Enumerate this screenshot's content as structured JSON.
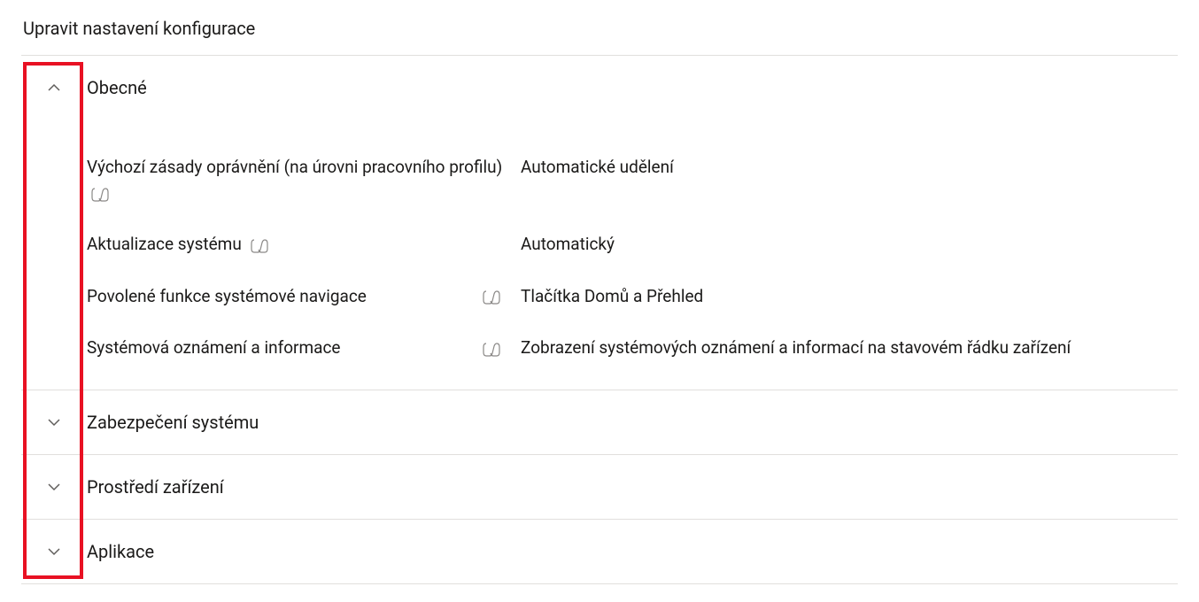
{
  "page": {
    "title": "Upravit nastavení konfigurace"
  },
  "sections": [
    {
      "title": "Obecné",
      "expanded": true,
      "settings": [
        {
          "label": "Výchozí zásady oprávnění (na úrovni pracovního profilu)",
          "value": "Automatické udělení",
          "icon_inline": true
        },
        {
          "label": "Aktualizace systému",
          "value": "Automatický",
          "icon_inline": true
        },
        {
          "label": "Povolené funkce systémové navigace",
          "value": "Tlačítka Domů a Přehled",
          "icon_trailing": true
        },
        {
          "label": "Systémová oznámení a informace",
          "value": "Zobrazení systémových oznámení a informací na stavovém řádku zařízení",
          "icon_trailing": true
        }
      ]
    },
    {
      "title": "Zabezpečení systému",
      "expanded": false
    },
    {
      "title": "Prostředí zařízení",
      "expanded": false
    },
    {
      "title": "Aplikace",
      "expanded": false
    }
  ]
}
